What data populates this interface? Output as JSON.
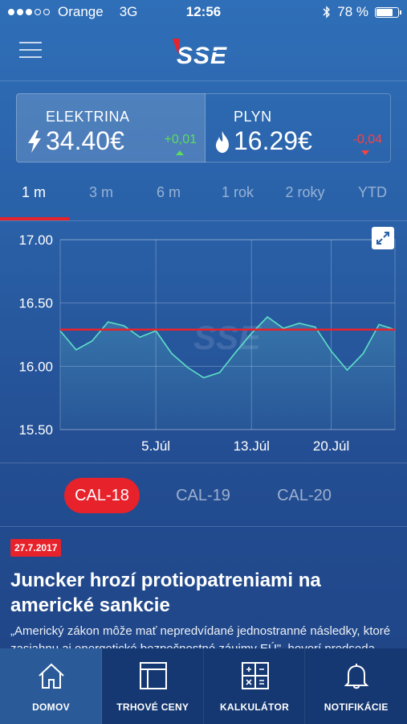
{
  "status_bar": {
    "carrier": "Orange",
    "network": "3G",
    "time": "12:56",
    "battery": "78 %",
    "battery_level": 0.78
  },
  "header": {
    "logo_text": "SSE"
  },
  "prices": {
    "electricity": {
      "label": "ELEKTRINA",
      "value": "34.40€",
      "change": "+0,01",
      "direction": "up"
    },
    "gas": {
      "label": "PLYN",
      "value": "16.29€",
      "change": "-0,04",
      "direction": "down"
    }
  },
  "periods": [
    "1 m",
    "3 m",
    "6 m",
    "1 rok",
    "2 roky",
    "YTD"
  ],
  "active_period": "1 m",
  "chart_data": {
    "type": "line",
    "x": [
      "Jun 27",
      "Jun 28",
      "Jun 29",
      "Jun 30",
      "Jul 3",
      "Jul 4",
      "Jul 5",
      "Jul 6",
      "Jul 7",
      "Jul 10",
      "Jul 11",
      "Jul 12",
      "Jul 13",
      "Jul 14",
      "Jul 17",
      "Jul 18",
      "Jul 19",
      "Jul 20",
      "Jul 21",
      "Jul 24",
      "Jul 25",
      "Jul 26",
      "Jul 27"
    ],
    "series": [
      {
        "values": [
          16.28,
          16.13,
          16.2,
          16.35,
          16.32,
          16.23,
          16.28,
          16.1,
          15.99,
          15.91,
          15.95,
          16.11,
          16.26,
          16.39,
          16.3,
          16.34,
          16.31,
          16.12,
          15.97,
          16.1,
          16.33,
          16.29
        ]
      }
    ],
    "reference_value": 16.29,
    "y_ticks": [
      "17.00",
      "16.50",
      "16.00",
      "15.50"
    ],
    "ylim": [
      15.5,
      17.0
    ],
    "x_ticks": [
      "5.Júl",
      "13.Júl",
      "20.Júl"
    ],
    "grid": true,
    "colors": {
      "line": "#5ee0c8",
      "reference": "#e8222b"
    }
  },
  "contracts": [
    "CAL-18",
    "CAL-19",
    "CAL-20"
  ],
  "active_contract": "CAL-18",
  "news": {
    "date": "27.7.2017",
    "title": "Juncker hrozí protiopatreniami na americké sankcie",
    "text": "„Americký zákon môže mať nepredvídané jednostranné následky, ktoré zasiahnu aj energetické bezpečnostné záujmy EÚ\", hovorí predseda"
  },
  "bottom_nav": [
    {
      "label": "DOMOV",
      "icon": "home-icon"
    },
    {
      "label": "TRHOVÉ CENY",
      "icon": "market-prices-icon"
    },
    {
      "label": "KALKULÁTOR",
      "icon": "calculator-icon"
    },
    {
      "label": "NOTIFIKÁCIE",
      "icon": "bell-icon"
    }
  ]
}
